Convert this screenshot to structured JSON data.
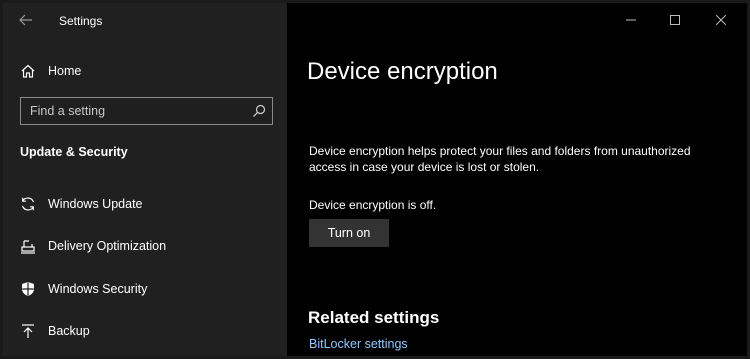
{
  "window": {
    "title": "Settings",
    "controls": {
      "minimize": "minimize",
      "maximize": "maximize",
      "close": "close"
    }
  },
  "sidebar": {
    "home_label": "Home",
    "search_placeholder": "Find a setting",
    "section_heading": "Update & Security",
    "items": [
      {
        "label": "Windows Update",
        "icon": "refresh-icon"
      },
      {
        "label": "Delivery Optimization",
        "icon": "delivery-optimization-icon"
      },
      {
        "label": "Windows Security",
        "icon": "shield-icon"
      },
      {
        "label": "Backup",
        "icon": "upload-arrow-icon"
      }
    ]
  },
  "main": {
    "title": "Device encryption",
    "description": "Device encryption helps protect your files and folders from unauthorized access in case your device is lost or stolen.",
    "status": "Device encryption is off.",
    "turn_on_label": "Turn on",
    "related_heading": "Related settings",
    "bitlocker_link": "BitLocker settings"
  },
  "colors": {
    "sidebar_bg": "#202020",
    "main_bg": "#000000",
    "button_bg": "#333333",
    "link": "#8fc9ff",
    "text": "#ffffff"
  }
}
